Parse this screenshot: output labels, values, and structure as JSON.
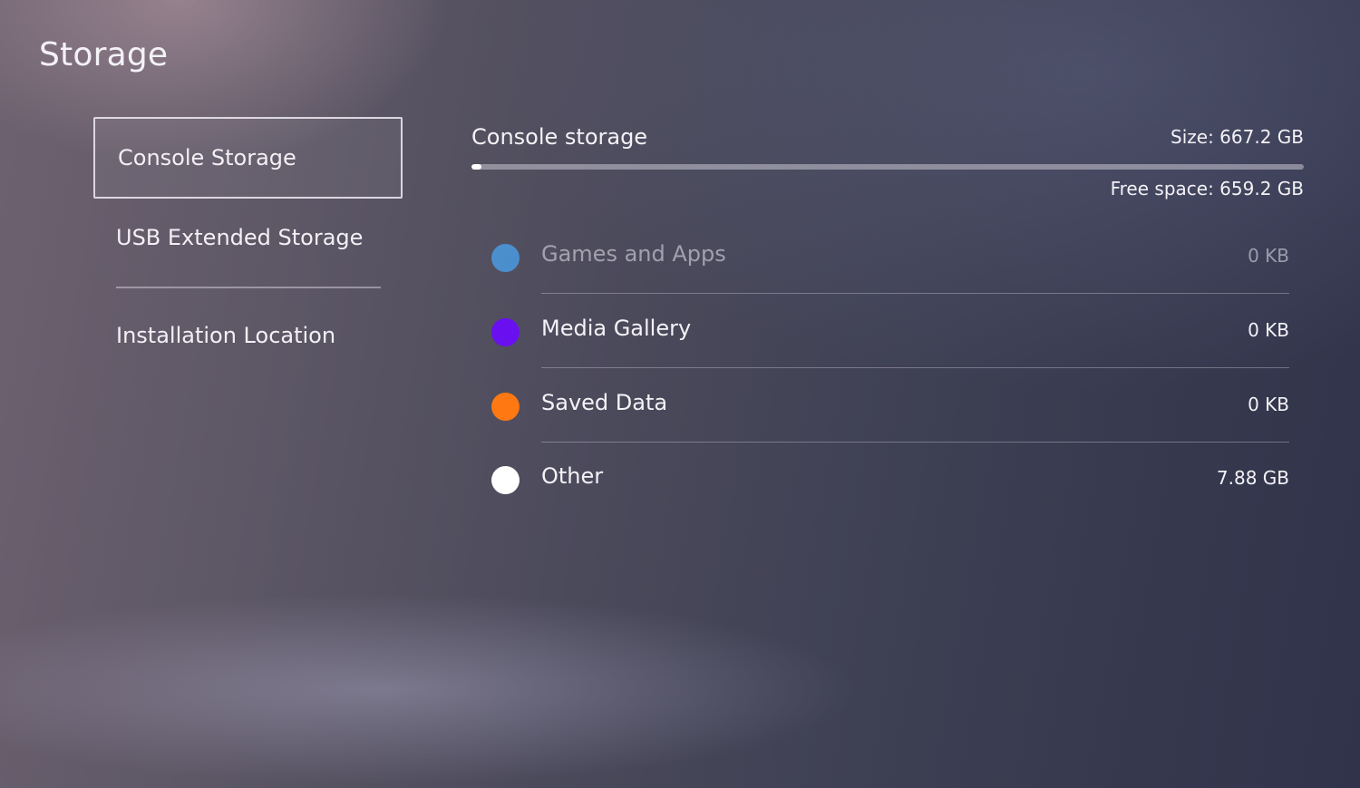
{
  "page_title": "Storage",
  "sidebar": {
    "items": [
      {
        "label": "Console Storage",
        "selected": true
      },
      {
        "label": "USB Extended Storage",
        "selected": false
      },
      {
        "label": "Installation Location",
        "selected": false
      }
    ]
  },
  "storage": {
    "title": "Console storage",
    "size_text": "Size: 667.2 GB",
    "free_text": "Free space: 659.2 GB",
    "used_fraction": 0.012,
    "categories": [
      {
        "label": "Games and Apps",
        "amount": "0 KB",
        "color": "#4a9ae0",
        "dimmed": true
      },
      {
        "label": "Media Gallery",
        "amount": "0 KB",
        "color": "#6a0ff0",
        "dimmed": false
      },
      {
        "label": "Saved Data",
        "amount": "0 KB",
        "color": "#ff7812",
        "dimmed": false
      },
      {
        "label": "Other",
        "amount": "7.88 GB",
        "color": "#ffffff",
        "dimmed": false
      }
    ]
  }
}
